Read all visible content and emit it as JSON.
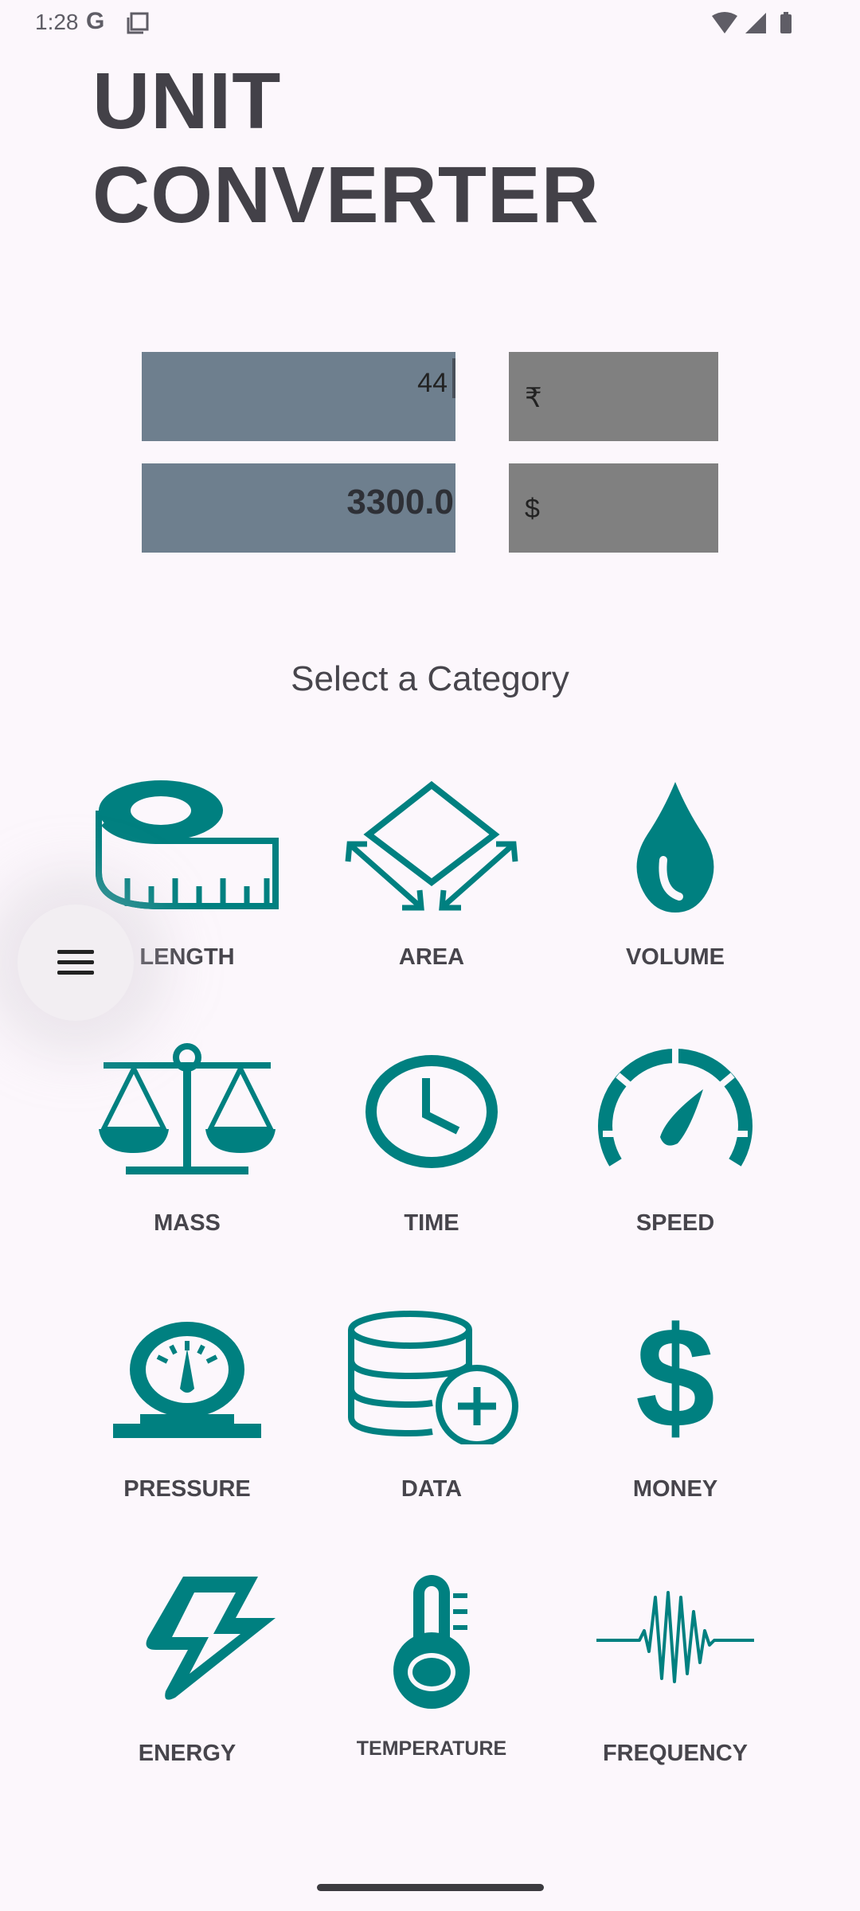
{
  "status_bar": {
    "time": "1:28",
    "g_label": "G",
    "icons": [
      "google-icon",
      "copy-icon",
      "wifi-icon",
      "signal-icon",
      "battery-icon"
    ]
  },
  "title": {
    "line1": "UNIT",
    "line2": "CONVERTER"
  },
  "converter": {
    "input_value": "44",
    "input_currency": "₹",
    "output_value": "3300.0",
    "output_currency": "$"
  },
  "select_heading": "Select a Category",
  "categories": [
    {
      "label": "LENGTH",
      "icon": "measuring-tape-icon"
    },
    {
      "label": "AREA",
      "icon": "area-icon"
    },
    {
      "label": "VOLUME",
      "icon": "water-drop-icon"
    },
    {
      "label": "MASS",
      "icon": "scale-icon"
    },
    {
      "label": "TIME",
      "icon": "clock-icon"
    },
    {
      "label": "SPEED",
      "icon": "speedometer-icon"
    },
    {
      "label": "PRESSURE",
      "icon": "pressure-gauge-icon"
    },
    {
      "label": "DATA",
      "icon": "database-add-icon"
    },
    {
      "label": "MONEY",
      "icon": "dollar-icon"
    },
    {
      "label": "ENERGY",
      "icon": "lightning-icon"
    },
    {
      "label": "TEMPERATURE",
      "icon": "thermometer-icon"
    },
    {
      "label": "FREQUENCY",
      "icon": "waveform-icon"
    }
  ],
  "colors": {
    "icon_teal": "#008080",
    "background": "#fcf7fc",
    "input_field": "#6e7f8e",
    "currency_field": "#808080"
  },
  "fab": {
    "icon": "menu-icon"
  }
}
